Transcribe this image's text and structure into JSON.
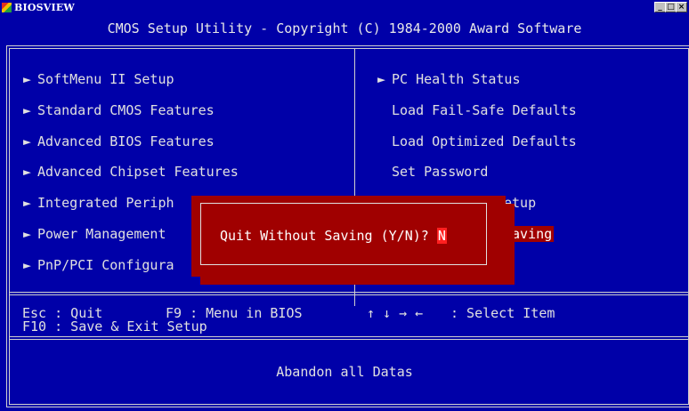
{
  "window": {
    "title": "BIOSVIEW",
    "controls": [
      "_",
      "□",
      "×"
    ]
  },
  "header": {
    "text": "CMOS Setup Utility - Copyright (C) 1984-2000 Award Software"
  },
  "menu": {
    "left": [
      {
        "label": "SoftMenu II Setup",
        "arrow": "►"
      },
      {
        "label": "Standard CMOS Features",
        "arrow": "►"
      },
      {
        "label": "Advanced BIOS Features",
        "arrow": "►"
      },
      {
        "label": "Advanced Chipset Features",
        "arrow": "►"
      },
      {
        "label": "Integrated Periph",
        "arrow": "►"
      },
      {
        "label": "Power Management",
        "arrow": "►"
      },
      {
        "label": "PnP/PCI Configura",
        "arrow": "►"
      }
    ],
    "right": [
      {
        "label": "PC Health Status",
        "arrow": "►"
      },
      {
        "label": "Load Fail-Safe Defaults"
      },
      {
        "label": "Load Optimized Defaults"
      },
      {
        "label": "Set Password"
      },
      {
        "label": "etup"
      },
      {
        "label": "Saving",
        "highlighted": true
      }
    ]
  },
  "help": {
    "line1_left": "Esc : Quit",
    "line1_mid": "F9 : Menu in BIOS",
    "line1_arrows": "↑ ↓ → ←",
    "line1_right": ": Select Item",
    "line2": "F10 : Save & Exit Setup"
  },
  "dialog": {
    "prompt": "Quit Without Saving (Y/N)?",
    "value": "N"
  },
  "status": {
    "text": "Abandon all Datas"
  },
  "colors": {
    "background": "#0000a8",
    "highlight": "#a00000",
    "text": "#e0e0e0"
  }
}
